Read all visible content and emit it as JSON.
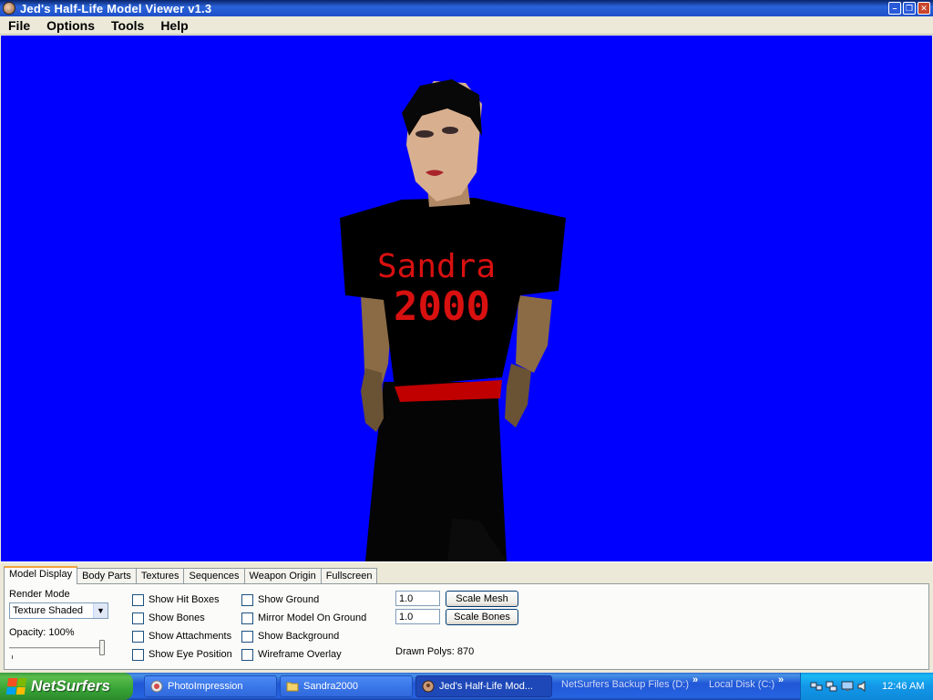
{
  "window": {
    "title": "Jed's Half-Life Model Viewer v1.3",
    "min_icon": "minimize-icon",
    "max_icon": "maximize-icon",
    "close_icon": "close-icon"
  },
  "menu": [
    "File",
    "Options",
    "Tools",
    "Help"
  ],
  "viewport": {
    "background": "#0000FF",
    "shirt_text_line1": "Sandra",
    "shirt_text_line2": "2000"
  },
  "tabs": [
    "Model Display",
    "Body Parts",
    "Textures",
    "Sequences",
    "Weapon Origin",
    "Fullscreen"
  ],
  "model_display": {
    "render_mode_label": "Render Mode",
    "render_mode_value": "Texture Shaded",
    "opacity_label": "Opacity: 100%",
    "opacity_value": 1.0,
    "checkboxes_col1": [
      "Show Hit Boxes",
      "Show Bones",
      "Show Attachments",
      "Show Eye Position"
    ],
    "checkboxes_col2": [
      "Show Ground",
      "Mirror Model On Ground",
      "Show Background",
      "Wireframe Overlay"
    ],
    "scale_mesh_value": "1.0",
    "scale_mesh_button": "Scale Mesh",
    "scale_bones_value": "1.0",
    "scale_bones_button": "Scale Bones",
    "drawn_polys": "Drawn Polys: 870"
  },
  "taskbar": {
    "start_label": "NetSurfers",
    "tasks": [
      {
        "label": "PhotoImpression",
        "icon": "photoimpression-icon"
      },
      {
        "label": "Sandra2000",
        "icon": "folder-icon"
      },
      {
        "label": "Jed's Half-Life Mod...",
        "icon": "model-viewer-icon"
      }
    ],
    "quicklinks": [
      "NetSurfers Backup Files (D:)",
      "Local Disk (C:)"
    ],
    "clock": "12:46 AM"
  }
}
